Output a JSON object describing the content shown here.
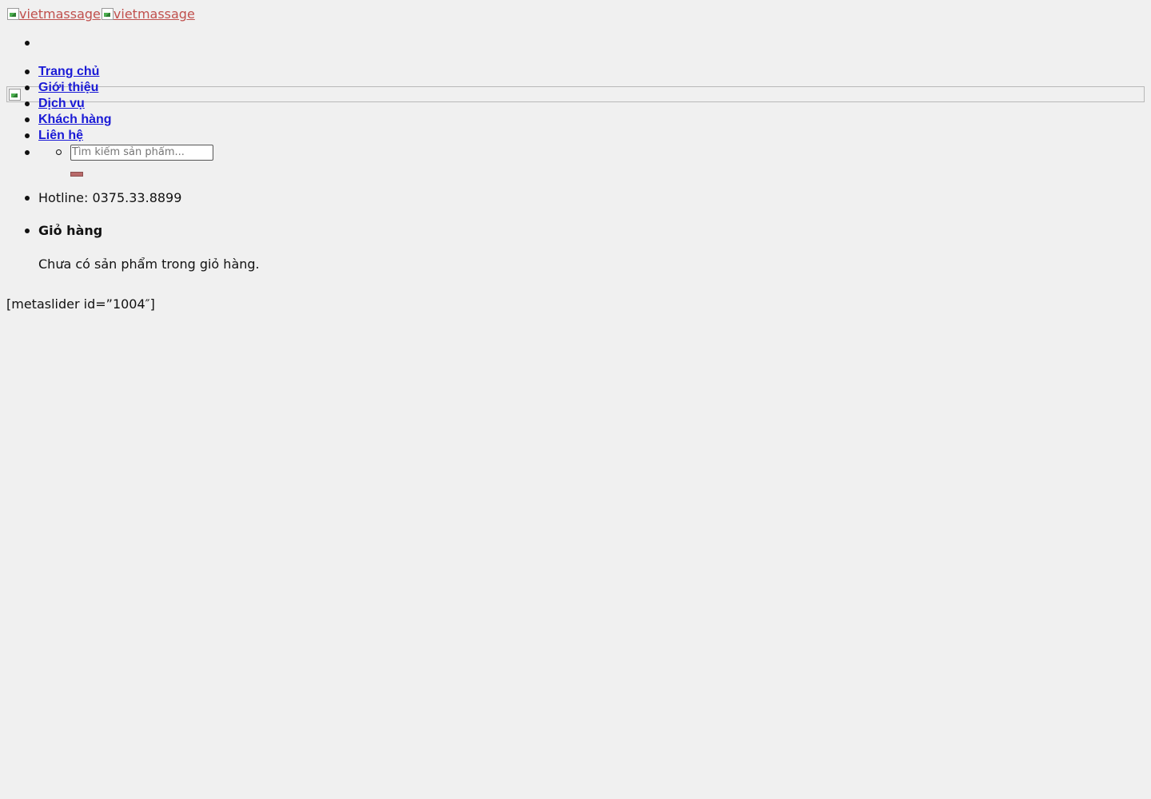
{
  "header": {
    "logo_alt": "vietmassage",
    "logo_sticky_alt": "vietmassage"
  },
  "nav": {
    "items": [
      {
        "label": "Trang chủ"
      },
      {
        "label": "Giới thiệu"
      },
      {
        "label": "Dịch vụ"
      },
      {
        "label": "Khách hàng"
      },
      {
        "label": "Liên hệ"
      }
    ],
    "search": {
      "placeholder": "Tìm kiếm sản phẩm...",
      "value": ""
    }
  },
  "hotline": {
    "text": "Hotline: 0375.33.8899"
  },
  "cart": {
    "title": "Giỏ hàng",
    "empty_message": "Chưa có sản phẩm trong giỏ hàng."
  },
  "content": {
    "shortcode_text": "[metaslider id=”1004″]"
  },
  "colors": {
    "background": "#f0f0f0",
    "link_nav": "#1a1ad6",
    "link_logo": "#c0504d",
    "search_button": "#b96a6a"
  }
}
